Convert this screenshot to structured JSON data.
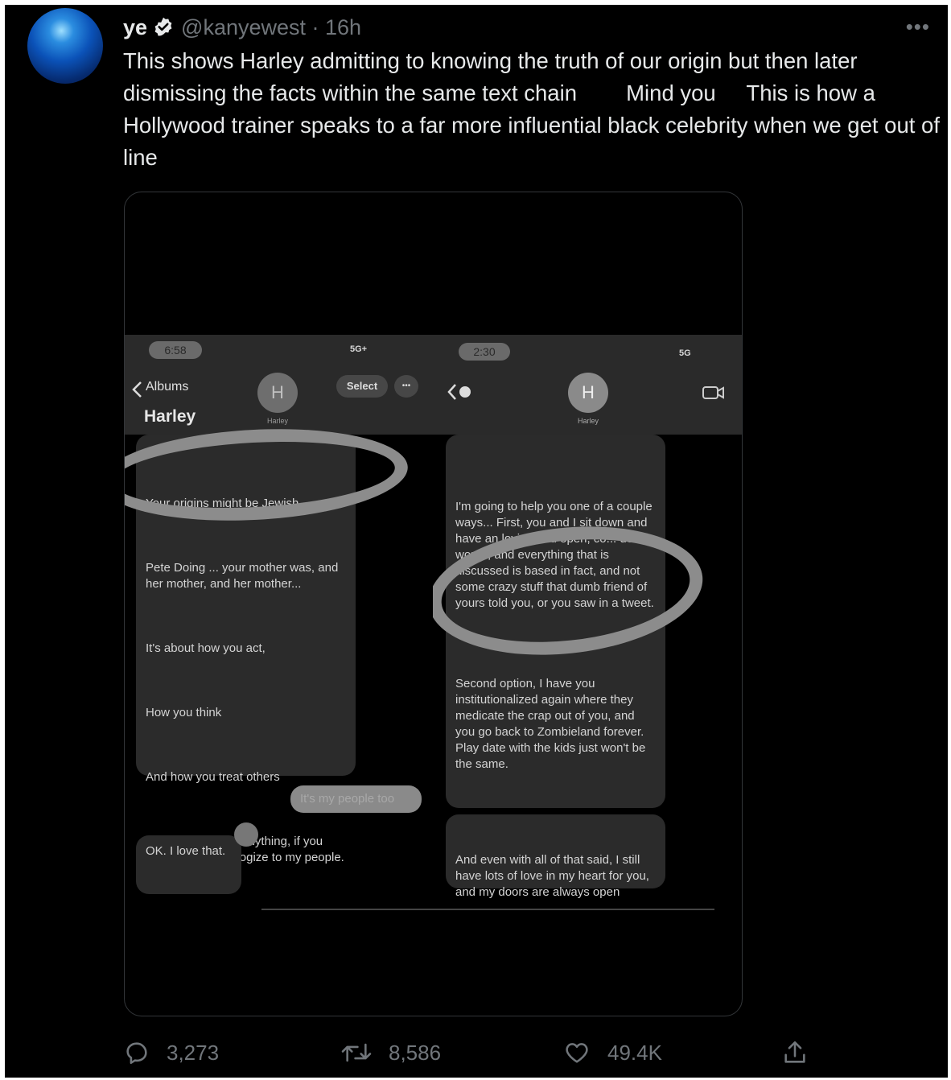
{
  "tweet": {
    "name": "ye",
    "handle_time": "@kanyewest · 16h",
    "more": "•••",
    "text": "This shows Harley admitting to knowing the truth of our origin but then later dismissing the facts within the same text chain        Mind you     This is how a Hollywood trainer speaks to a far more influential black celebrity when we get out of line"
  },
  "screenshot_left": {
    "time": "6:58",
    "signal": "5G+",
    "back_label": "Albums",
    "avatar_letter": "H",
    "contact_caption": "Harley",
    "select_label": "Select",
    "more": "•••",
    "title": "Harley",
    "messages": [
      "Your origins might be Jewish....",
      "Pete Doing ... your mother was, and her mother, and her mother...",
      "It's about how you act,",
      "How you think",
      "And how you treat others",
      "I will do anything, anything, if you could please apologize to my people."
    ],
    "sent_message": "It's my people too",
    "reply": "OK. I love that."
  },
  "screenshot_right": {
    "time": "2:30",
    "signal": "5G",
    "avatar_letter": "H",
    "contact_caption": "Harley",
    "message_1": "I'm going to help you one of a couple ways... First, you and I sit down and have an loving and open, co... de... words, and everything that is discussed is based in fact, and not some crazy stuff that dumb friend of yours told you, or you saw in a tweet.",
    "message_2": "Second option, I have you institutionalized again where they medicate the crap out of you, and you go back to Zombieland forever. Play date with the kids just won't be the same.",
    "message_3": "And even with all of that said, I still have lots of love in my heart for you, and my doors are always open"
  },
  "actions": {
    "replies": "3,273",
    "retweets": "8,586",
    "likes": "49.4K"
  },
  "colors": {
    "background": "#000000",
    "text": "#e7e9ea",
    "muted": "#71767b",
    "verified": "#ffffff"
  }
}
